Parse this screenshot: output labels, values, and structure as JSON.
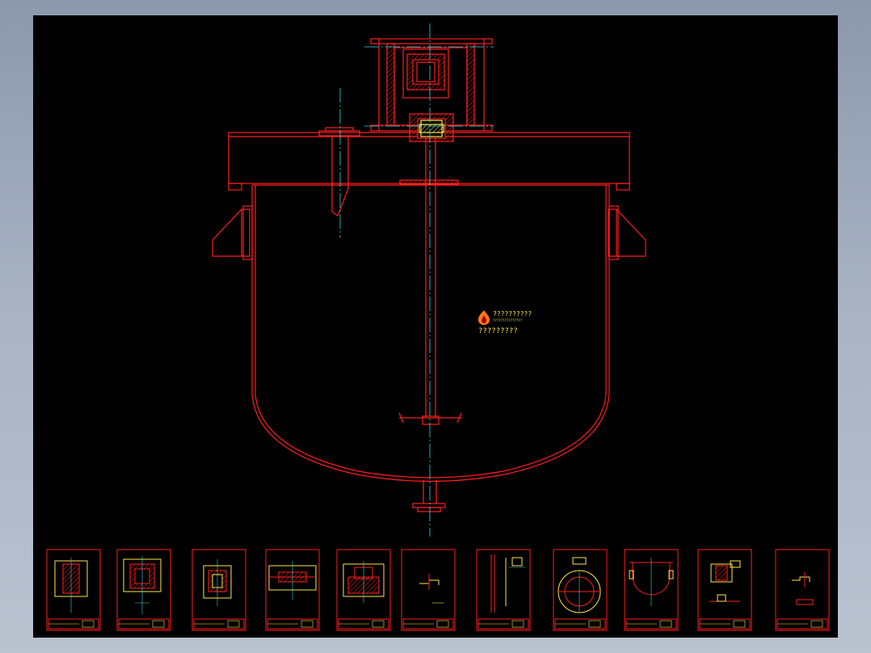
{
  "watermark": {
    "line1": "??????????",
    "line2": "???????????????",
    "line3": "?????????",
    "logo_icon": "flame-logo-icon"
  },
  "colors": {
    "background": "#000000",
    "outline": "#ff1e1e",
    "centerline": "#36d7e6",
    "annotation": "#ffe84a",
    "frame_bg": "#a8b2c2"
  },
  "thumbnails": [
    {
      "title": "thumbnail-1"
    },
    {
      "title": "thumbnail-2"
    },
    {
      "title": "thumbnail-3"
    },
    {
      "title": "thumbnail-4"
    },
    {
      "title": "thumbnail-5"
    },
    {
      "title": "thumbnail-6"
    },
    {
      "title": "thumbnail-7"
    },
    {
      "title": "thumbnail-8"
    },
    {
      "title": "thumbnail-9"
    },
    {
      "title": "thumbnail-10"
    },
    {
      "title": "thumbnail-11"
    }
  ]
}
